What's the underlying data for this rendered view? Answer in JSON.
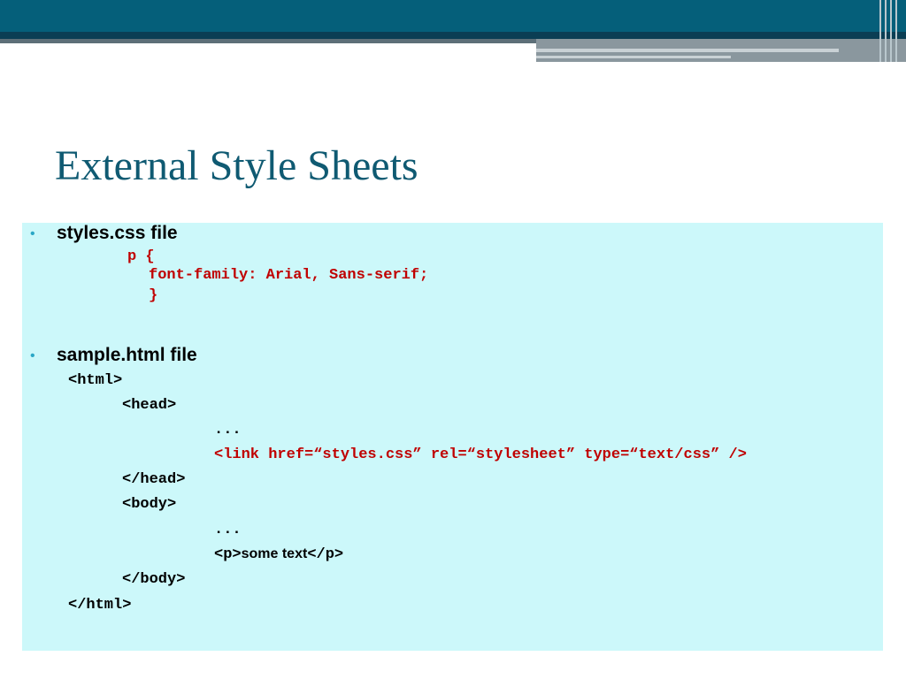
{
  "slide": {
    "title": "External Style Sheets"
  },
  "section_css": {
    "bullet": "•",
    "heading": "styles.css file",
    "code": [
      "p {",
      "font-family: Arial, Sans-serif;",
      "}"
    ]
  },
  "section_html": {
    "bullet": "•",
    "heading": "sample.html file",
    "lines": {
      "html_open": "<html>",
      "head_open": "<head>",
      "dots1": "...",
      "link": "<link href=“styles.css” rel=“stylesheet” type=“text/css” />",
      "head_close": "</head>",
      "body_open": "<body>",
      "dots2": "...",
      "p_open": "<p>",
      "p_text": "some text",
      "p_close": "</p>",
      "body_close": "</body>",
      "html_close": "</html>"
    }
  },
  "colors": {
    "header": "#055f7a",
    "title": "#0f5a72",
    "content_background": "#ccf8fa",
    "code_highlight": "#c00000",
    "bullet": "#2aa7c6"
  }
}
